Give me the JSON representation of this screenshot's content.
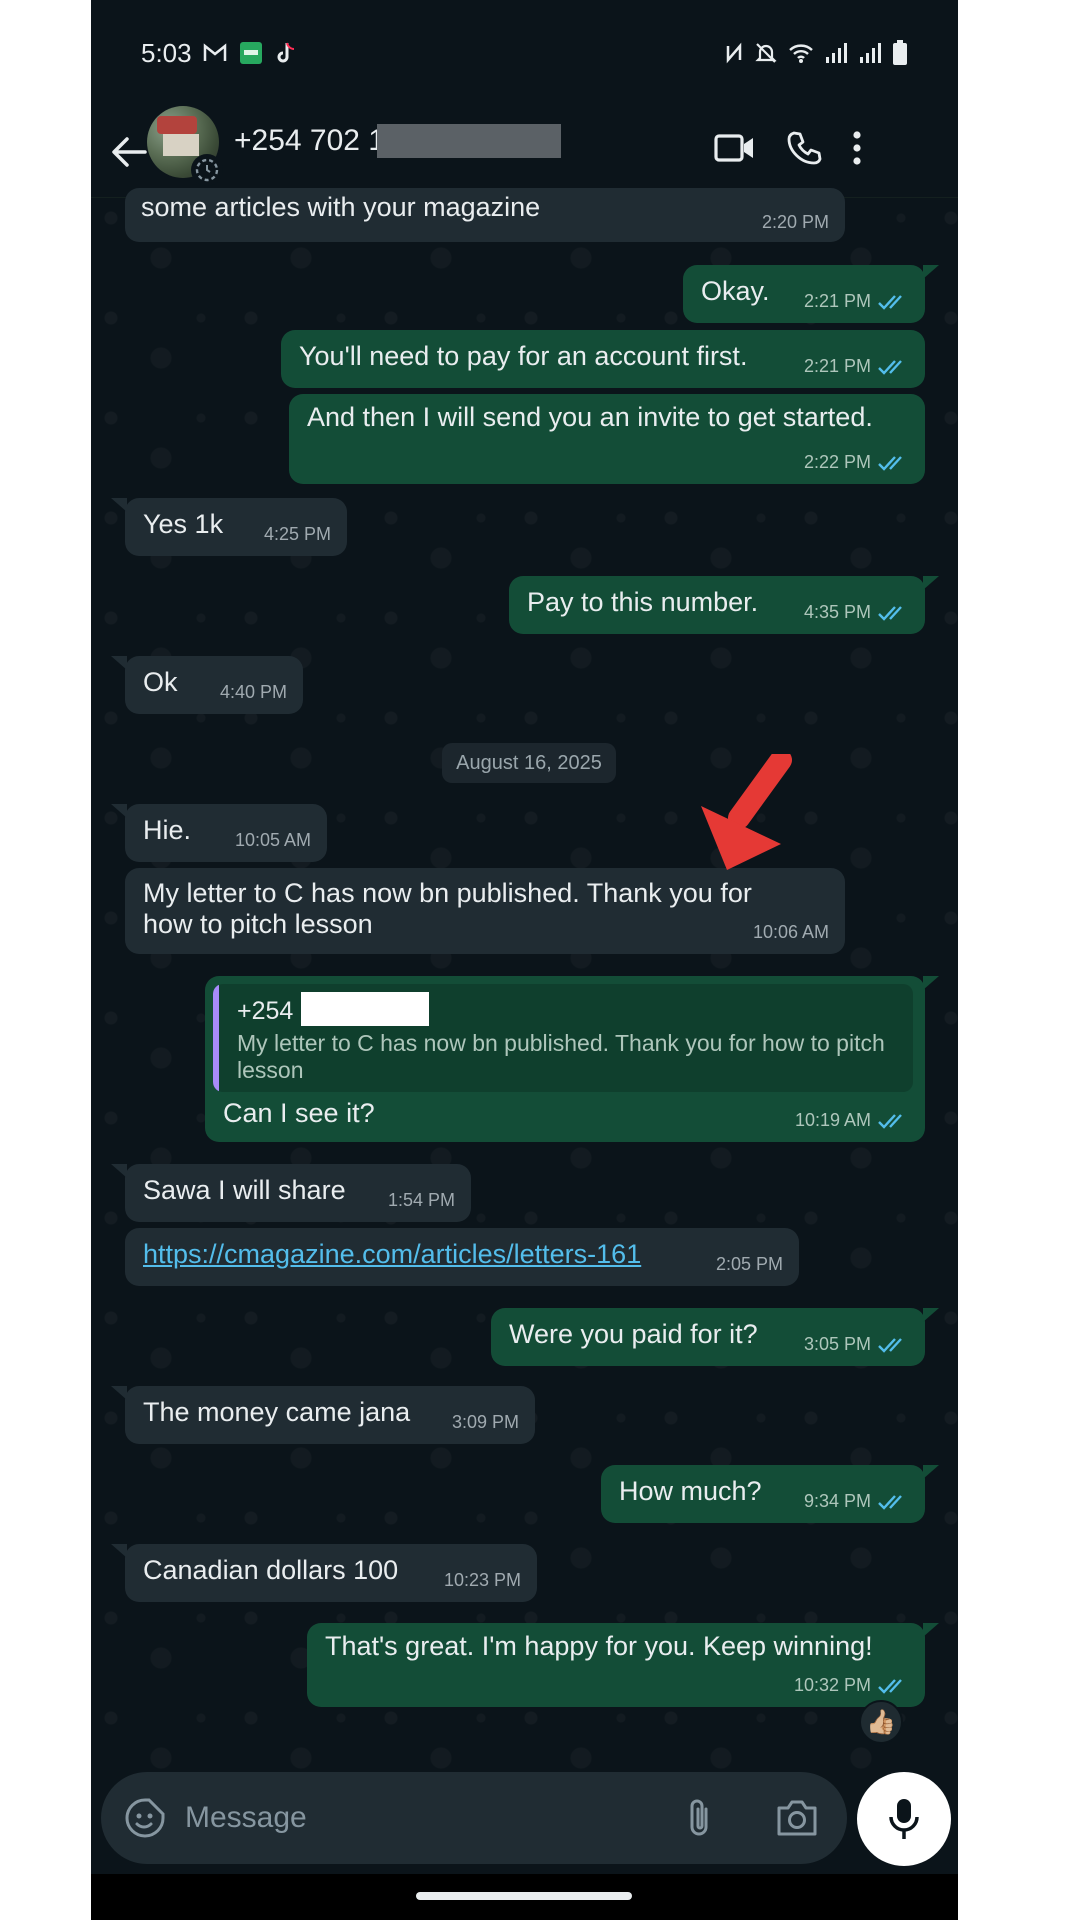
{
  "status_bar": {
    "time": "5:03",
    "left_icons": [
      "gmail-icon",
      "app-icon",
      "tiktok-icon"
    ],
    "right_icons": [
      "nfc-icon",
      "mute-icon",
      "wifi-icon",
      "signal-icon",
      "signal-icon",
      "battery-icon"
    ]
  },
  "header": {
    "contact_name": "+254 702 1",
    "icons": [
      "back-arrow-icon",
      "video-call-icon",
      "phone-icon",
      "more-vert-icon"
    ]
  },
  "messages": [
    {
      "dir": "in",
      "text": "some articles with your magazine",
      "time": "2:20 PM"
    },
    {
      "dir": "out",
      "text": "Okay.",
      "time": "2:21 PM"
    },
    {
      "dir": "out",
      "text": "You'll need to pay for an account first.",
      "time": "2:21 PM"
    },
    {
      "dir": "out",
      "text": "And then I will send you an invite to get started.",
      "time": "2:22 PM"
    },
    {
      "dir": "in",
      "text": "Yes 1k",
      "time": "4:25 PM"
    },
    {
      "dir": "out",
      "text": "Pay to this number.",
      "time": "4:35 PM"
    },
    {
      "dir": "in",
      "text": "Ok",
      "time": "4:40 PM"
    },
    {
      "dir": "in",
      "text": "Hie.",
      "time": "10:05 AM"
    },
    {
      "dir": "in",
      "text_line1": "My letter to C has now bn published.  Thank you for",
      "text_line2": "how to pitch lesson",
      "time": "10:06 AM"
    },
    {
      "dir": "out",
      "text": "Can I see it?",
      "time": "10:19 AM",
      "quote": {
        "sender": "+254",
        "text": "My letter to C has now bn published.  Thank you for how to pitch lesson"
      }
    },
    {
      "dir": "in",
      "text": "Sawa I will share",
      "time": "1:54 PM"
    },
    {
      "dir": "in",
      "text": "https://cmagazine.com/articles/letters-161",
      "time": "2:05 PM"
    },
    {
      "dir": "out",
      "text": "Were you paid for it?",
      "time": "3:05 PM"
    },
    {
      "dir": "in",
      "text": "The money came jana",
      "time": "3:09 PM"
    },
    {
      "dir": "out",
      "text": "How much?",
      "time": "9:34 PM"
    },
    {
      "dir": "in",
      "text": "Canadian dollars 100",
      "time": "10:23 PM"
    },
    {
      "dir": "out",
      "text": "That's great. I'm happy for you. Keep winning!",
      "time": "10:32 PM",
      "reaction": "👍🏼"
    }
  ],
  "date_divider": "August 16, 2025",
  "composer": {
    "placeholder": "Message",
    "icons": [
      "sticker-icon",
      "paperclip-icon",
      "camera-icon",
      "mic-icon"
    ]
  },
  "colors": {
    "chat_bg": "#0b141a",
    "incoming_bubble": "#202c33",
    "outgoing_bubble": "#134d37",
    "read_ticks": "#53bdeb",
    "link": "#53bdeb",
    "annotation_arrow": "#e53935"
  }
}
